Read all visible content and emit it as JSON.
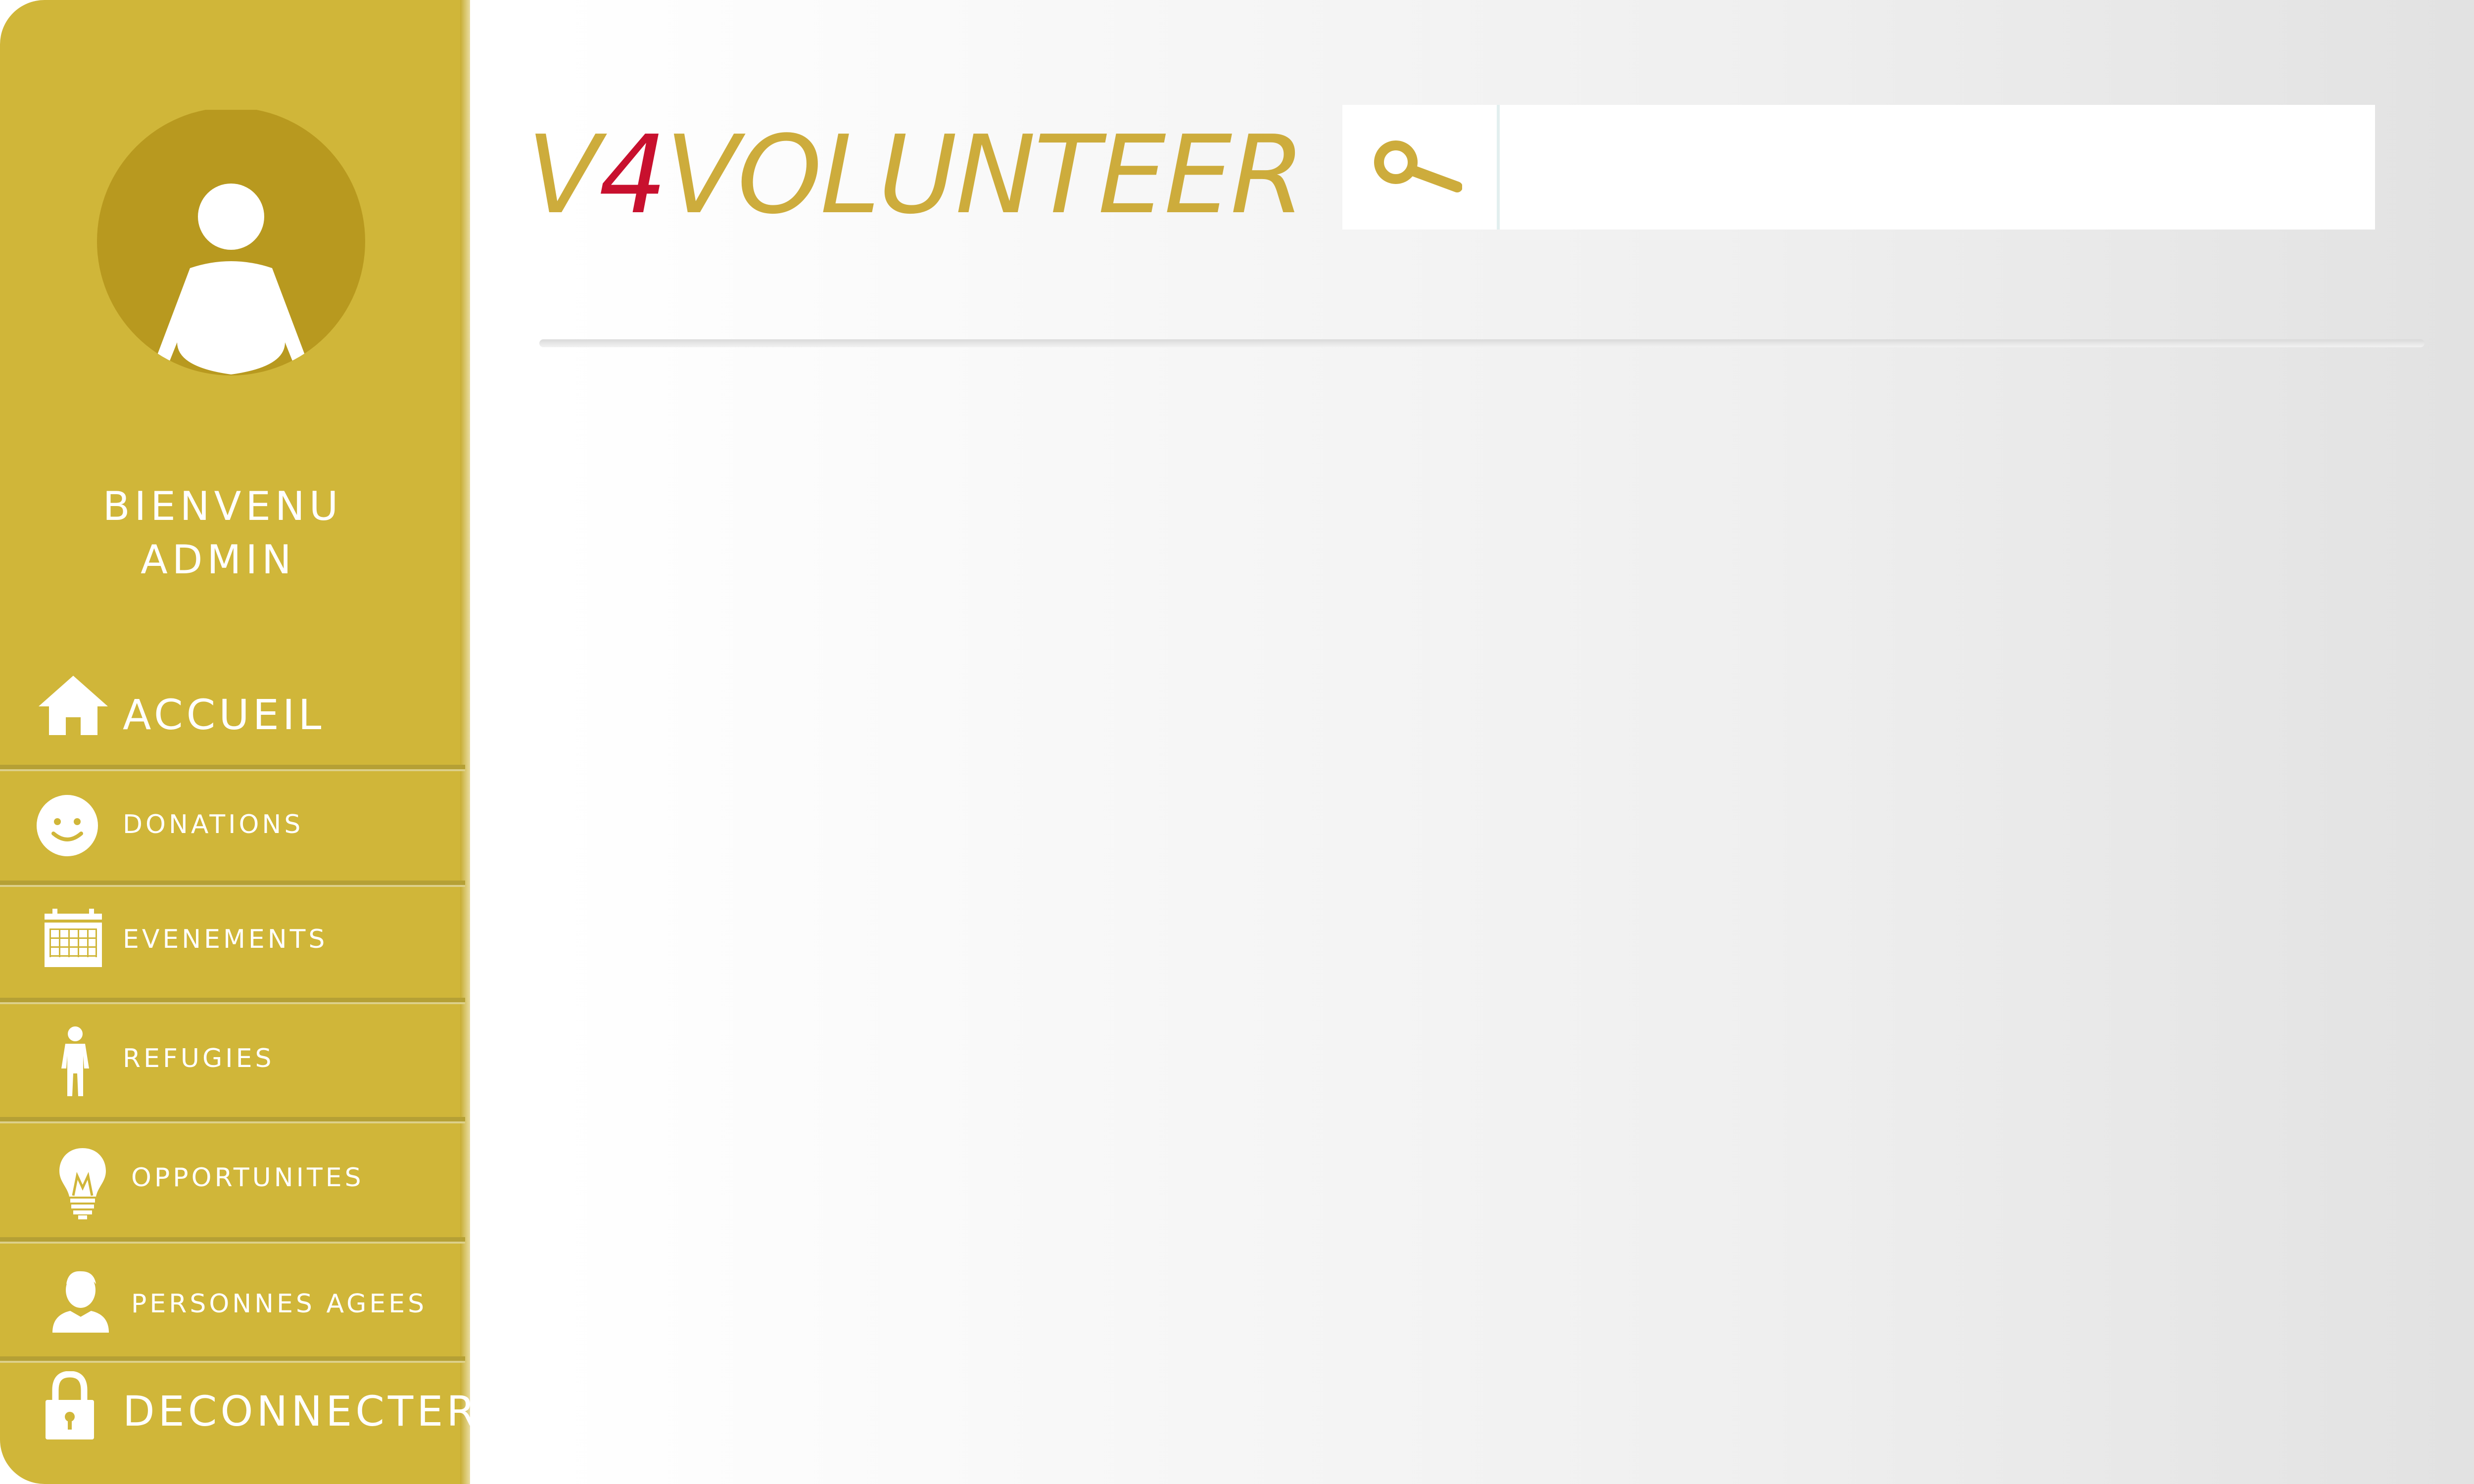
{
  "sidebar": {
    "welcome_line1": "BIENVENU",
    "welcome_line2": "ADMIN",
    "items": [
      {
        "label": "ACCUEIL",
        "icon": "home-icon"
      },
      {
        "label": "DONATIONS",
        "icon": "smiley-icon"
      },
      {
        "label": "EVENEMENTS",
        "icon": "calendar-icon"
      },
      {
        "label": "REFUGIES",
        "icon": "person-icon"
      },
      {
        "label": "OPPORTUNITES",
        "icon": "lightbulb-icon"
      },
      {
        "label": "PERSONNES AGEES",
        "icon": "elderly-person-icon"
      },
      {
        "label": "DECONNECTER",
        "icon": "lock-icon"
      }
    ]
  },
  "header": {
    "logo_prefix": "V",
    "logo_number": "4",
    "logo_suffix": "VOLUNTEER",
    "search": {
      "placeholder": "",
      "value": "",
      "icon": "search-icon"
    }
  },
  "colors": {
    "sidebar_bg": "#d0b639",
    "logo_gold": "#cdac3c",
    "logo_red": "#c8102e",
    "avatar_bg": "#b8991f"
  }
}
